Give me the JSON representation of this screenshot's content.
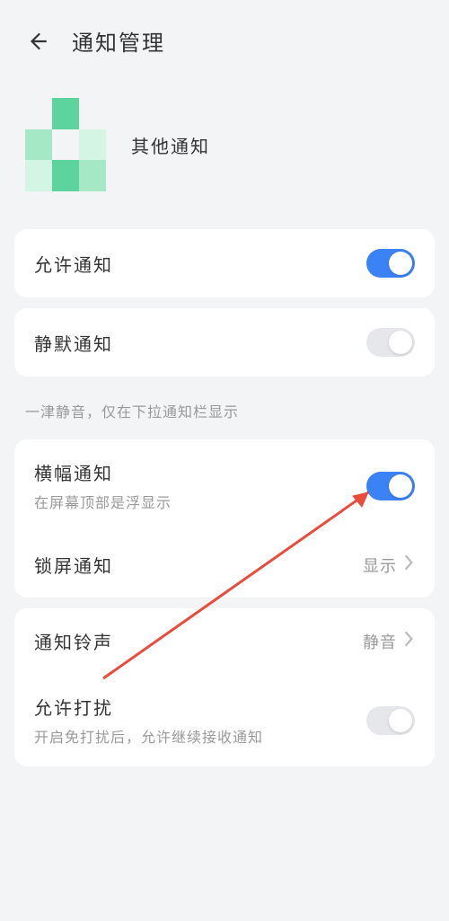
{
  "header": {
    "title": "通知管理"
  },
  "app": {
    "name": "其他通知"
  },
  "allowNotify": {
    "label": "允许通知",
    "on": true
  },
  "silent": {
    "label": "静默通知",
    "on": false
  },
  "silentHint": "一津静音，仅在下拉通知栏显示",
  "banner": {
    "label": "横幅通知",
    "desc": "在屏幕顶部是浮显示",
    "on": true
  },
  "lockscreen": {
    "label": "锁屏通知",
    "value": "显示"
  },
  "ringtone": {
    "label": "通知铃声",
    "value": "静音"
  },
  "dnd": {
    "label": "允许打扰",
    "desc": "开启免打扰后，允许继续接收通知",
    "on": false
  }
}
